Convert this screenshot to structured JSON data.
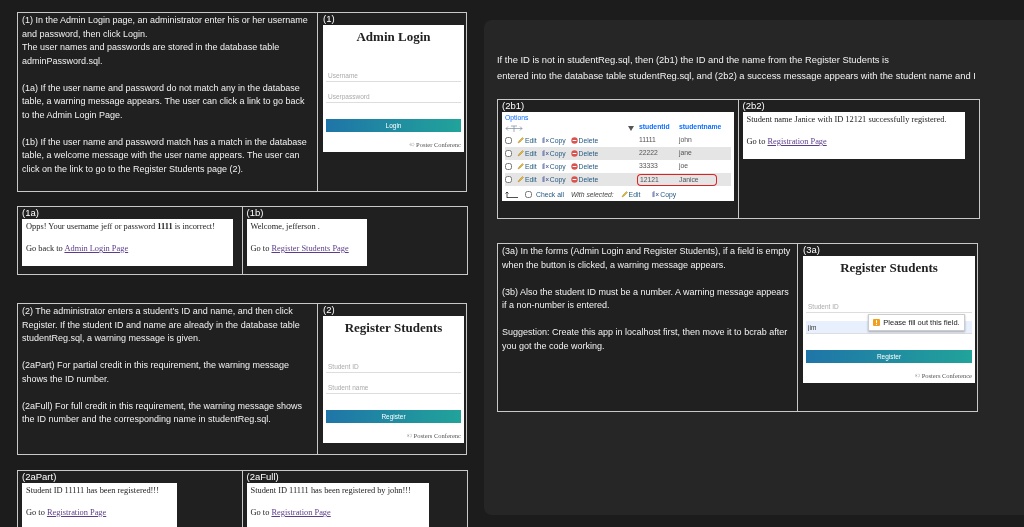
{
  "left_tables": [
    {
      "kind": "requirement",
      "description": [
        [
          "(1) In the Admin Login page, an administrator enter his or her username and password, then click Login.",
          "The user names and passwords are stored in the database table adminPassword.sql."
        ],
        [
          "(1a) If the user name and password do not match any in the database table, a warning message appears.  The user can click a link to go back to the Admin Login Page."
        ],
        [
          "(1b) If the user name and password match has a match in the database table, a welcome message with the user name appears. The user can click on the link to go to the Register Students page (2)."
        ]
      ],
      "label": "(1)",
      "screenshot": {
        "kind": "form",
        "title": "Admin Login",
        "fields": [
          {
            "placeholder": "Username"
          },
          {
            "placeholder": "Userpassword"
          }
        ],
        "button": "Login",
        "footer": "© Poster Conferenc"
      }
    },
    {
      "kind": "results",
      "cells": [
        {
          "label": "(1a)",
          "screenshot": {
            "kind": "message",
            "text": "Opps! Your username jeff or password **1111** is incorrect!",
            "link_prefix": "Go back to",
            "link": "Admin Login Page"
          }
        },
        {
          "label": "(1b)",
          "screenshot": {
            "kind": "message",
            "text": "Welcome, jefferson .",
            "link_prefix": "Go to",
            "link": "Register Students Page"
          }
        }
      ]
    },
    {
      "kind": "requirement",
      "description": [
        [
          "(2) The administrator enters a student’s ID and name, and then click Register. If the student ID and name are already in the database table studentReg.sql, a warning message is given."
        ],
        [
          "(2aPart) For partial credit in this requirement, the warning message shows the ID number."
        ],
        [
          "(2aFull) For full credit in this requirement, the warning message shows the ID number and the corresponding name in studentReg.sql."
        ]
      ],
      "label": "(2)",
      "screenshot": {
        "kind": "form",
        "title": "Register Students",
        "fields": [
          {
            "placeholder": "Student ID"
          },
          {
            "placeholder": "Student name"
          }
        ],
        "button": "Register",
        "footer": "© Posters Conferenc"
      }
    },
    {
      "kind": "results",
      "cells": [
        {
          "label": "(2aPart)",
          "screenshot": {
            "kind": "message",
            "text": "Student ID 11111 has been registered!!!",
            "link_prefix": "Go to",
            "link": "Registration Page"
          }
        },
        {
          "label": "(2aFull)",
          "screenshot": {
            "kind": "message",
            "text": "Student ID 11111 has been registered by john!!!",
            "link_prefix": "Go to",
            "link": "Registration Page"
          }
        }
      ]
    }
  ],
  "right_panel": {
    "intro": [
      "If the ID is not in studentReg.sql, then (2b1) the ID and the name from the Register Students  is",
      "entered into the database table studentReg.sql, and (2b2) a success message appears with the student name and I"
    ],
    "tables": [
      {
        "kind": "results",
        "cells": [
          {
            "label": "(2b1)",
            "screenshot": {
              "kind": "db_table",
              "options": "Options",
              "columns": [
                "studentid",
                "studentname"
              ],
              "rows": [
                {
                  "checked": false,
                  "actions": [
                    {
                      "kind": "edit",
                      "label": "Edit"
                    },
                    {
                      "kind": "copy",
                      "label": "Copy"
                    },
                    {
                      "kind": "delete",
                      "label": "Delete"
                    }
                  ],
                  "cells": [
                    "11111",
                    "john"
                  ],
                  "highlighted": false
                },
                {
                  "checked": false,
                  "actions": [
                    {
                      "kind": "edit",
                      "label": "Edit"
                    },
                    {
                      "kind": "copy",
                      "label": "Copy"
                    },
                    {
                      "kind": "delete",
                      "label": "Delete"
                    }
                  ],
                  "cells": [
                    "22222",
                    "jane"
                  ],
                  "highlighted": false
                },
                {
                  "checked": false,
                  "actions": [
                    {
                      "kind": "edit",
                      "label": "Edit"
                    },
                    {
                      "kind": "copy",
                      "label": "Copy"
                    },
                    {
                      "kind": "delete",
                      "label": "Delete"
                    }
                  ],
                  "cells": [
                    "33333",
                    "joe"
                  ],
                  "highlighted": false
                },
                {
                  "checked": false,
                  "actions": [
                    {
                      "kind": "edit",
                      "label": "Edit"
                    },
                    {
                      "kind": "copy",
                      "label": "Copy"
                    },
                    {
                      "kind": "delete",
                      "label": "Delete"
                    }
                  ],
                  "cells": [
                    "12121",
                    "Janice"
                  ],
                  "highlighted": true
                }
              ],
              "footer": {
                "check_all": "Check all",
                "check_all_checked": false,
                "with_selected": "With selected:",
                "actions": [
                  {
                    "kind": "edit",
                    "label": "Edit"
                  },
                  {
                    "kind": "copy",
                    "label": "Copy"
                  }
                ]
              }
            }
          },
          {
            "label": "(2b2)",
            "screenshot": {
              "kind": "message",
              "text": "Student name Janice with ID 12121 successfully registered.",
              "link_prefix": "Go to",
              "link": "Registration Page"
            }
          }
        ]
      },
      {
        "kind": "requirement",
        "description": [
          [
            "(3a) In the forms (Admin Login and Register Students), if a field is empty when the button is clicked, a warning message appears."
          ],
          [
            "(3b) Also the student ID must be a number.  A warning message appears if a non-number is entered."
          ],
          [
            "Suggestion: Create this app in localhost first, then move it to bcrab after you got the code working."
          ]
        ],
        "label": "(3a)",
        "screenshot": {
          "kind": "form",
          "title": "Register Students",
          "fields": [
            {
              "placeholder": "Student ID"
            },
            {
              "value": "jim"
            }
          ],
          "tooltip": "Please fill out this field.",
          "button": "Register",
          "footer": "© Posters Conference"
        }
      }
    ]
  }
}
